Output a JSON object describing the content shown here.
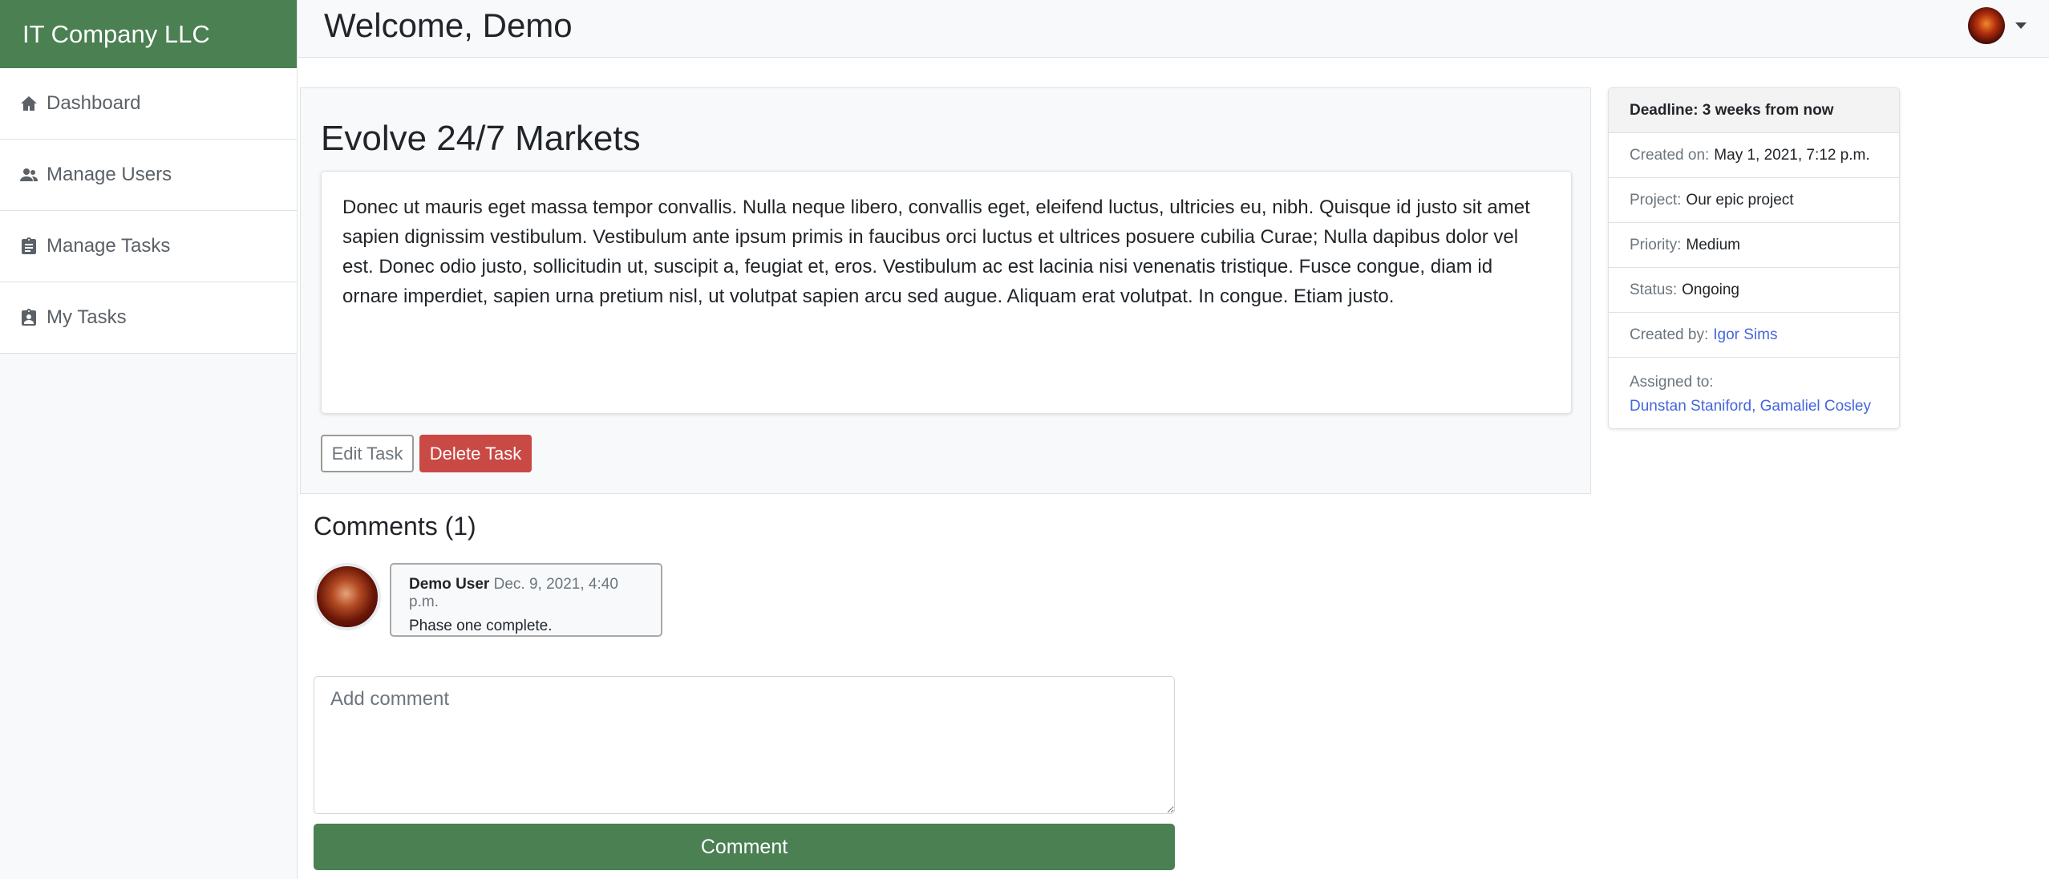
{
  "sidebar": {
    "brand": "IT Company LLC",
    "items": [
      {
        "label": "Dashboard",
        "icon": "home-icon"
      },
      {
        "label": "Manage Users",
        "icon": "users-icon"
      },
      {
        "label": "Manage Tasks",
        "icon": "clipboard-icon"
      },
      {
        "label": "My Tasks",
        "icon": "clipboard-user-icon"
      }
    ]
  },
  "header": {
    "welcome": "Welcome, Demo"
  },
  "task": {
    "title": "Evolve 24/7 Markets",
    "description": "Donec ut mauris eget massa tempor convallis. Nulla neque libero, convallis eget, eleifend luctus, ultricies eu, nibh. Quisque id justo sit amet sapien dignissim vestibulum. Vestibulum ante ipsum primis in faucibus orci luctus et ultrices posuere cubilia Curae; Nulla dapibus dolor vel est. Donec odio justo, sollicitudin ut, suscipit a, feugiat et, eros. Vestibulum ac est lacinia nisi venenatis tristique. Fusce congue, diam id ornare imperdiet, sapien urna pretium nisl, ut volutpat sapien arcu sed augue. Aliquam erat volutpat. In congue. Etiam justo.",
    "edit_label": "Edit Task",
    "delete_label": "Delete Task"
  },
  "info": {
    "deadline": "Deadline: 3 weeks from now",
    "created_on_label": "Created on:",
    "created_on": "May 1, 2021, 7:12 p.m.",
    "project_label": "Project:",
    "project": "Our epic project",
    "priority_label": "Priority:",
    "priority": "Medium",
    "status_label": "Status:",
    "status": "Ongoing",
    "created_by_label": "Created by:",
    "created_by": "Igor Sims",
    "assigned_label": "Assigned to:",
    "assigned_1": "Dunstan Staniford",
    "assigned_sep": ", ",
    "assigned_2": "Gamaliel Cosley"
  },
  "comments": {
    "title": "Comments (1)",
    "items": [
      {
        "user": "Demo User",
        "date": "Dec. 9, 2021, 4:40 p.m.",
        "text": "Phase one complete."
      }
    ],
    "placeholder": "Add comment",
    "submit_label": "Comment"
  },
  "colors": {
    "brand": "#4a8052",
    "danger": "#c94a45",
    "link": "#4466dd"
  }
}
